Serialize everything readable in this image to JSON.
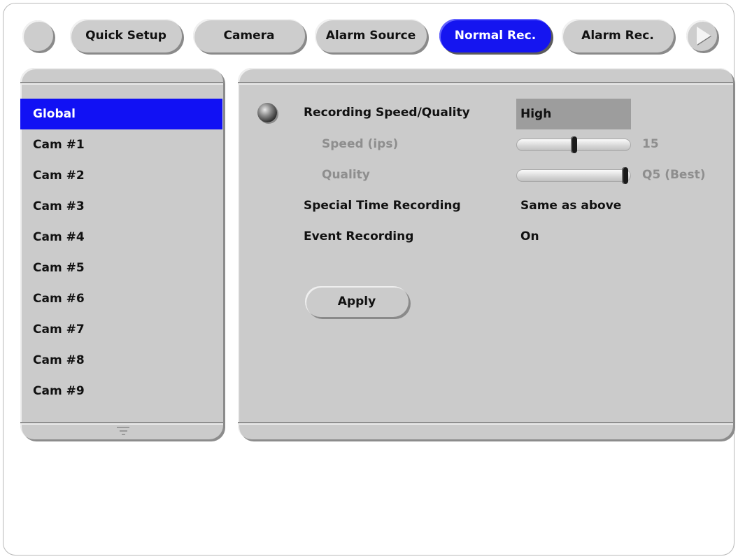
{
  "tabs": [
    {
      "label": "Quick Setup",
      "active": false
    },
    {
      "label": "Camera",
      "active": false
    },
    {
      "label": "Alarm Source",
      "active": false
    },
    {
      "label": "Normal Rec.",
      "active": true
    },
    {
      "label": "Alarm Rec.",
      "active": false
    }
  ],
  "sidebar": {
    "items": [
      "Global",
      "Cam #1",
      "Cam #2",
      "Cam #3",
      "Cam #4",
      "Cam #5",
      "Cam #6",
      "Cam #7",
      "Cam #8",
      "Cam #9"
    ],
    "selected": "Global"
  },
  "settings": {
    "recording_speed_quality": {
      "label": "Recording Speed/Quality",
      "value": "High"
    },
    "speed": {
      "label": "Speed (ips)",
      "value": "15",
      "slider_fraction": 0.5
    },
    "quality": {
      "label": "Quality",
      "value": "Q5 (Best)",
      "slider_fraction": 1.0
    },
    "special_time_recording": {
      "label": "Special Time Recording",
      "value": "Same as above"
    },
    "event_recording": {
      "label": "Event Recording",
      "value": "On"
    }
  },
  "apply_label": "Apply",
  "colors": {
    "accent": "#1111f4",
    "panel": "#cbcbcb",
    "dim_text": "#8e8e8e"
  }
}
